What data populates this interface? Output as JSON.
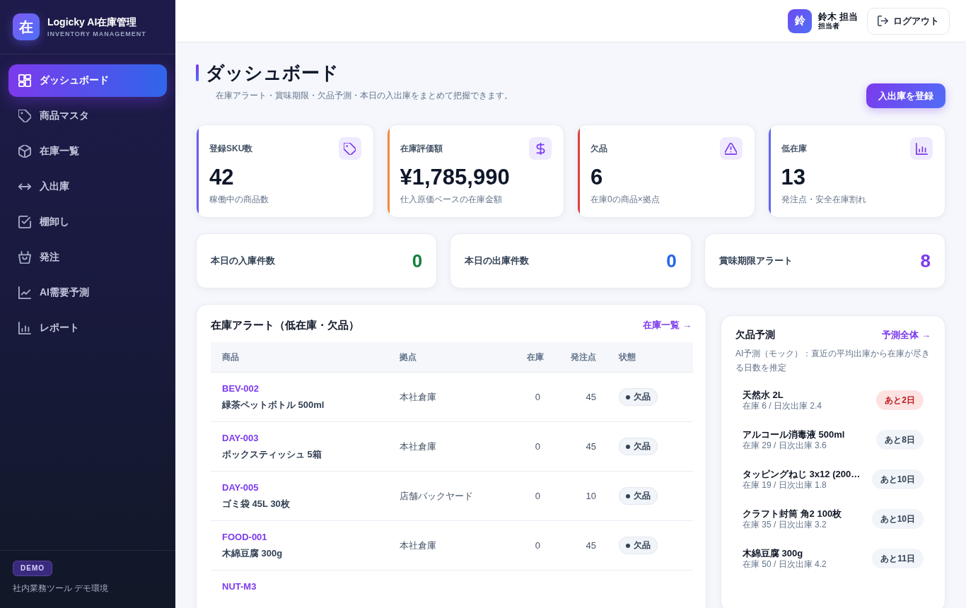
{
  "sidebar": {
    "logo": "在",
    "title": "Logicky AI在庫管理",
    "subtitle": "INVENTORY MANAGEMENT",
    "items": [
      {
        "label": "ダッシュボード",
        "selected": true
      },
      {
        "label": "商品マスタ",
        "selected": false
      },
      {
        "label": "在庫一覧",
        "selected": false
      },
      {
        "label": "入出庫",
        "selected": false
      },
      {
        "label": "棚卸し",
        "selected": false
      },
      {
        "label": "発注",
        "selected": false
      },
      {
        "label": "AI需要予測",
        "selected": false
      },
      {
        "label": "レポート",
        "selected": false
      }
    ],
    "footer": {
      "badge": "DEMO",
      "note": "社内業務ツール デモ環境"
    }
  },
  "header": {
    "avatar": "鈴",
    "user_name": "鈴木 担当",
    "user_role": "担当者",
    "logout": "ログアウト"
  },
  "page": {
    "title": "ダッシュボード",
    "subtitle": "在庫アラート・賞味期限・欠品予測・本日の入出庫をまとめて把握できます。",
    "action": "入出庫を登録"
  },
  "kpis": [
    {
      "label": "登録SKU数",
      "value": "42",
      "note": "稼働中の商品数",
      "color": "#6d5df0"
    },
    {
      "label": "在庫評価額",
      "value": "¥1,785,990",
      "note": "仕入原価ベースの在庫金額",
      "color": "#f28a3a"
    },
    {
      "label": "欠品",
      "value": "6",
      "note": "在庫0の商品×拠点",
      "color": "#dc4343"
    },
    {
      "label": "低在庫",
      "value": "13",
      "note": "発注点・安全在庫割れ",
      "color": "#6366f1"
    }
  ],
  "today": [
    {
      "label": "本日の入庫件数",
      "value": "0",
      "color": "#15803d"
    },
    {
      "label": "本日の出庫件数",
      "value": "0",
      "color": "#2563eb"
    },
    {
      "label": "賞味期限アラート",
      "value": "8",
      "color": "#7c3aed"
    }
  ],
  "alerts": {
    "title": "在庫アラート（低在庫・欠品）",
    "link": "在庫一覧 →",
    "columns": [
      "商品",
      "拠点",
      "在庫",
      "発注点",
      "状態"
    ],
    "rows": [
      {
        "sku": "BEV-002",
        "name": "緑茶ペットボトル 500ml",
        "location": "本社倉庫",
        "stock": "0",
        "reorder_point": "45",
        "status": "欠品"
      },
      {
        "sku": "DAY-003",
        "name": "ボックスティッシュ 5箱",
        "location": "本社倉庫",
        "stock": "0",
        "reorder_point": "45",
        "status": "欠品"
      },
      {
        "sku": "DAY-005",
        "name": "ゴミ袋 45L 30枚",
        "location": "店舗バックヤード",
        "stock": "0",
        "reorder_point": "10",
        "status": "欠品"
      },
      {
        "sku": "FOOD-001",
        "name": "木綿豆腐 300g",
        "location": "本社倉庫",
        "stock": "0",
        "reorder_point": "45",
        "status": "欠品"
      },
      {
        "sku": "NUT-M3"
      }
    ]
  },
  "forecast": {
    "title": "欠品予測",
    "link": "予測全体 →",
    "description": "AI予測（モック）：直近の平均出庫から在庫が尽きる日数を推定",
    "items": [
      {
        "name": "天然水 2L",
        "detail": "在庫 6 / 日次出庫 2.4",
        "badge": "あと2日",
        "urgent": true
      },
      {
        "name": "アルコール消毒液 500ml",
        "detail": "在庫 29 / 日次出庫 3.6",
        "badge": "あと8日",
        "urgent": false
      },
      {
        "name": "タッピングねじ 3x12 (200…",
        "detail": "在庫 19 / 日次出庫 1.8",
        "badge": "あと10日",
        "urgent": false
      },
      {
        "name": "クラフト封筒 角2 100枚",
        "detail": "在庫 35 / 日次出庫 3.2",
        "badge": "あと10日",
        "urgent": false
      },
      {
        "name": "木綿豆腐 300g",
        "detail": "在庫 50 / 日次出庫 4.2",
        "badge": "あと11日",
        "urgent": false
      }
    ]
  }
}
